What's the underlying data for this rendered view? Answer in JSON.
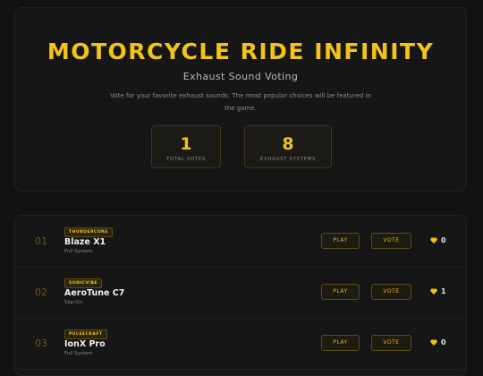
{
  "header": {
    "title": "MOTORCYCLE RIDE INFINITY",
    "subtitle": "Exhaust Sound Voting",
    "description": "Vote for your favorite exhaust sounds. The most popular choices will be featured in the game."
  },
  "stats": [
    {
      "value": "1",
      "label": "TOTAL VOTES"
    },
    {
      "value": "8",
      "label": "EXHAUST SYSTEMS"
    }
  ],
  "colors": {
    "accent": "#f2c41b",
    "background": "#121212",
    "card": "#161616"
  },
  "buttons": {
    "play_label": "PLAY",
    "vote_label": "VOTE"
  },
  "exhausts": [
    {
      "rank": "01",
      "brand": "THUNDERCORE",
      "name": "Blaze X1",
      "type": "Full System",
      "votes": "0"
    },
    {
      "rank": "02",
      "brand": "SONICVIBE",
      "name": "AeroTune C7",
      "type": "Slip-On",
      "votes": "1"
    },
    {
      "rank": "03",
      "brand": "PULSECRAFT",
      "name": "IonX Pro",
      "type": "Full System",
      "votes": "0"
    }
  ],
  "icons": {
    "like": "heart-icon"
  }
}
